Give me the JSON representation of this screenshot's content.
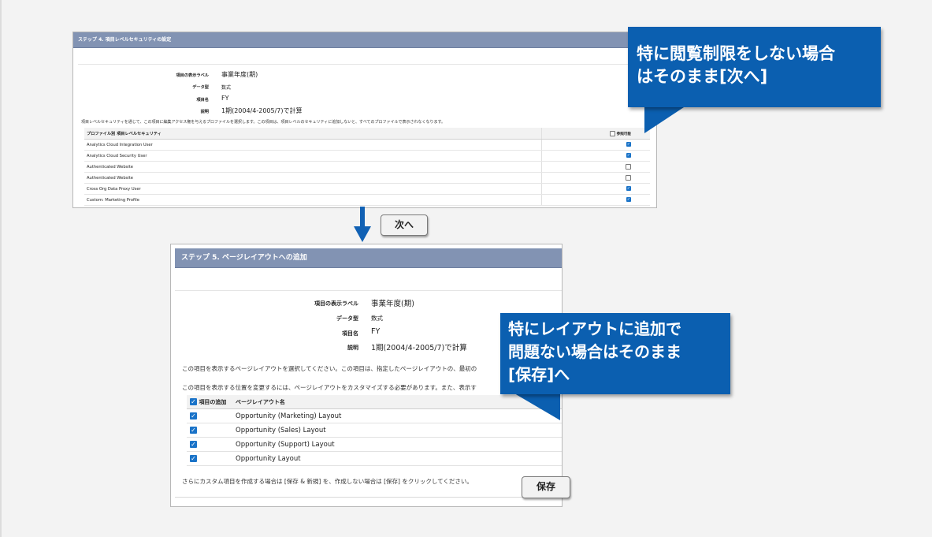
{
  "step4": {
    "title": "ステップ 4. 項目レベルセキュリティの設定",
    "fields": [
      {
        "label": "項目の表示ラベル",
        "value": "事業年度(期)"
      },
      {
        "label": "データ型",
        "value": "数式"
      },
      {
        "label": "項目名",
        "value": "FY"
      },
      {
        "label": "説明",
        "value": "1期(2004/4-2005/7)で計算"
      }
    ],
    "note": "項目レベルセキュリティを通じて、この項目に編集アクセス権を与えるプロファイルを選択します。この項目は、項目レベルのセキュリティに追加しないと、すべてのプロファイルで表示されなくなります。",
    "table": {
      "col_profile": "プロファイル別 項目レベルセキュリティ",
      "col_visible": "参照可能",
      "rows": [
        {
          "name": "Analytics Cloud Integration User",
          "checked": true
        },
        {
          "name": "Analytics Cloud Security User",
          "checked": true
        },
        {
          "name": "Authenticated Website",
          "checked": false
        },
        {
          "name": "Authenticated Website",
          "checked": false
        },
        {
          "name": "Cross Org Data Proxy User",
          "checked": true
        },
        {
          "name": "Custom: Marketing Profile",
          "checked": true
        }
      ]
    }
  },
  "next_button": "次へ",
  "step5": {
    "title": "ステップ 5. ページレイアウトへの追加",
    "fields": [
      {
        "label": "項目の表示ラベル",
        "value": "事業年度(期)"
      },
      {
        "label": "データ型",
        "value": "数式"
      },
      {
        "label": "項目名",
        "value": "FY"
      },
      {
        "label": "説明",
        "value": "1期(2004/4-2005/7)で計算"
      }
    ],
    "note1": "この項目を表示するページレイアウトを選択してください。この項目は、指定したページレイアウトの、最初の",
    "note2": "この項目を表示する位置を変更するには、ページレイアウトをカスタマイズする必要があります。また、表示す",
    "table": {
      "col_add": "項目の追加",
      "col_layout": "ページレイアウト名",
      "rows": [
        {
          "name": "Opportunity (Marketing) Layout",
          "checked": true
        },
        {
          "name": "Opportunity (Sales) Layout",
          "checked": true
        },
        {
          "name": "Opportunity (Support) Layout",
          "checked": true
        },
        {
          "name": "Opportunity Layout",
          "checked": true
        }
      ]
    },
    "footer": "さらにカスタム項目を作成する場合は [保存 & 新規] を、作成しない場合は [保存] をクリックしてください。"
  },
  "save_button": "保存",
  "callout1": {
    "line1": "特に閲覧制限をしない場合",
    "line2": "はそのまま[次へ]"
  },
  "callout2": {
    "line1": "特にレイアウトに追加で",
    "line2": "問題ない場合はそのまま",
    "line3": "[保存]へ"
  },
  "colors": {
    "header_bg": "#8293b3",
    "callout_bg": "#0b5fb0",
    "checkbox": "#1a73c8"
  }
}
